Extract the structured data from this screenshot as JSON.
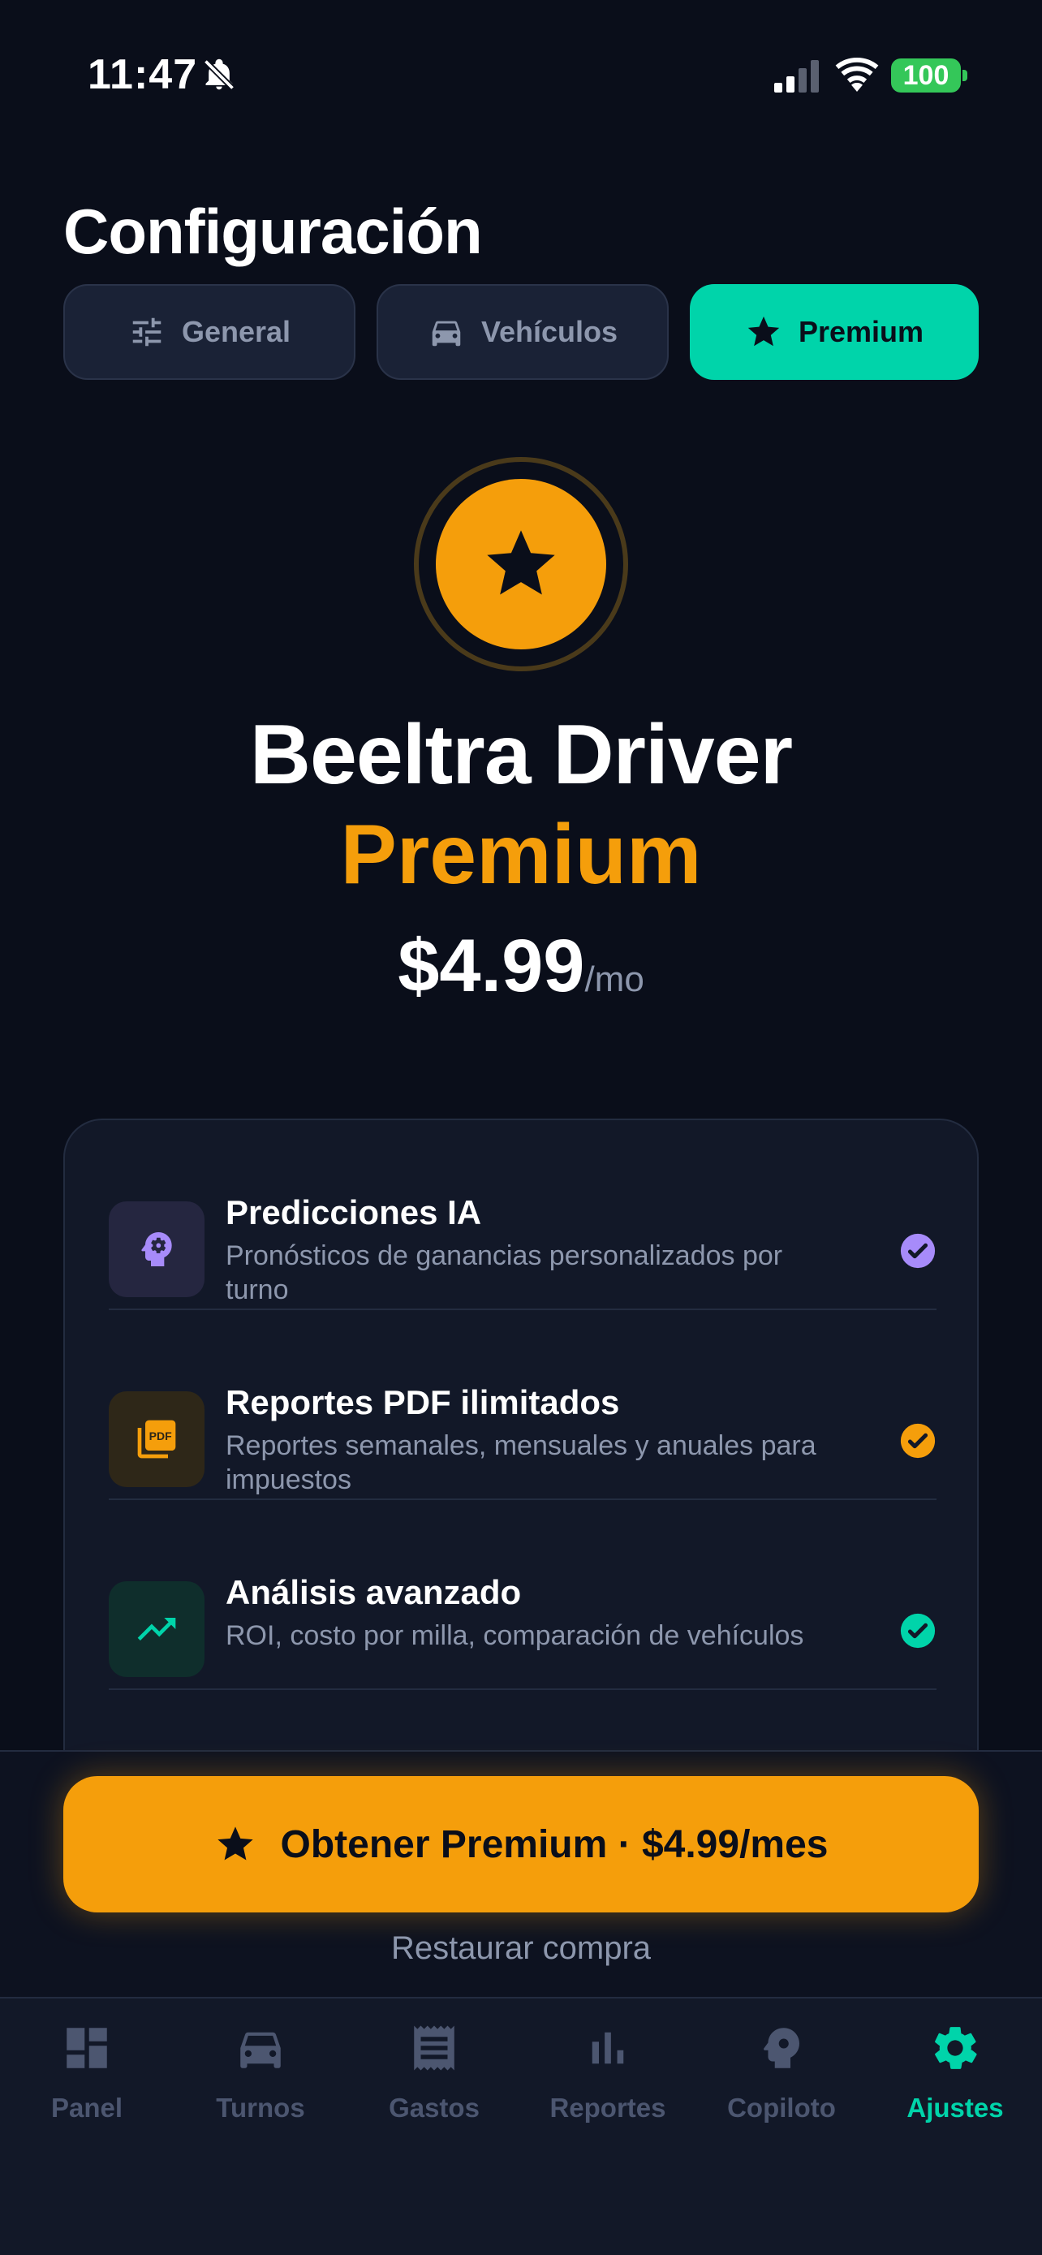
{
  "status_bar": {
    "time": "11:47",
    "battery": "100"
  },
  "header": {
    "title": "Configuración"
  },
  "tabs": [
    {
      "label": "General",
      "icon": "sliders-icon",
      "active": false
    },
    {
      "label": "Vehículos",
      "icon": "car-icon",
      "active": false
    },
    {
      "label": "Premium",
      "icon": "star-icon",
      "active": true
    }
  ],
  "hero": {
    "icon": "star-icon",
    "title": "Beeltra Driver",
    "subtitle": "Premium",
    "price": "$4.99",
    "period": "/mo"
  },
  "features": [
    {
      "title": "Predicciones IA",
      "description": "Pronósticos de ganancias personalizados por turno",
      "icon": "brain-icon",
      "accent": "#a78bfa"
    },
    {
      "title": "Reportes PDF ilimitados",
      "description": "Reportes semanales, mensuales y anuales para impuestos",
      "icon": "pdf-icon",
      "accent": "#f59e0b"
    },
    {
      "title": "Análisis avanzado",
      "description": "ROI, costo por milla, comparación de vehículos",
      "icon": "trending-up-icon",
      "accent": "#00d4aa"
    }
  ],
  "purchase": {
    "button_label": "Obtener Premium · $4.99/mes",
    "restore_label": "Restaurar compra"
  },
  "nav": [
    {
      "label": "Panel",
      "icon": "dashboard-icon",
      "active": false
    },
    {
      "label": "Turnos",
      "icon": "car-icon",
      "active": false
    },
    {
      "label": "Gastos",
      "icon": "receipt-icon",
      "active": false
    },
    {
      "label": "Reportes",
      "icon": "bar-chart-icon",
      "active": false
    },
    {
      "label": "Copiloto",
      "icon": "brain-icon",
      "active": false
    },
    {
      "label": "Ajustes",
      "icon": "gear-icon",
      "active": true
    }
  ],
  "colors": {
    "background": "#0a0e1a",
    "accent_teal": "#00d4aa",
    "accent_amber": "#f59e0b",
    "accent_purple": "#a78bfa",
    "muted_text": "#8d97ad"
  }
}
